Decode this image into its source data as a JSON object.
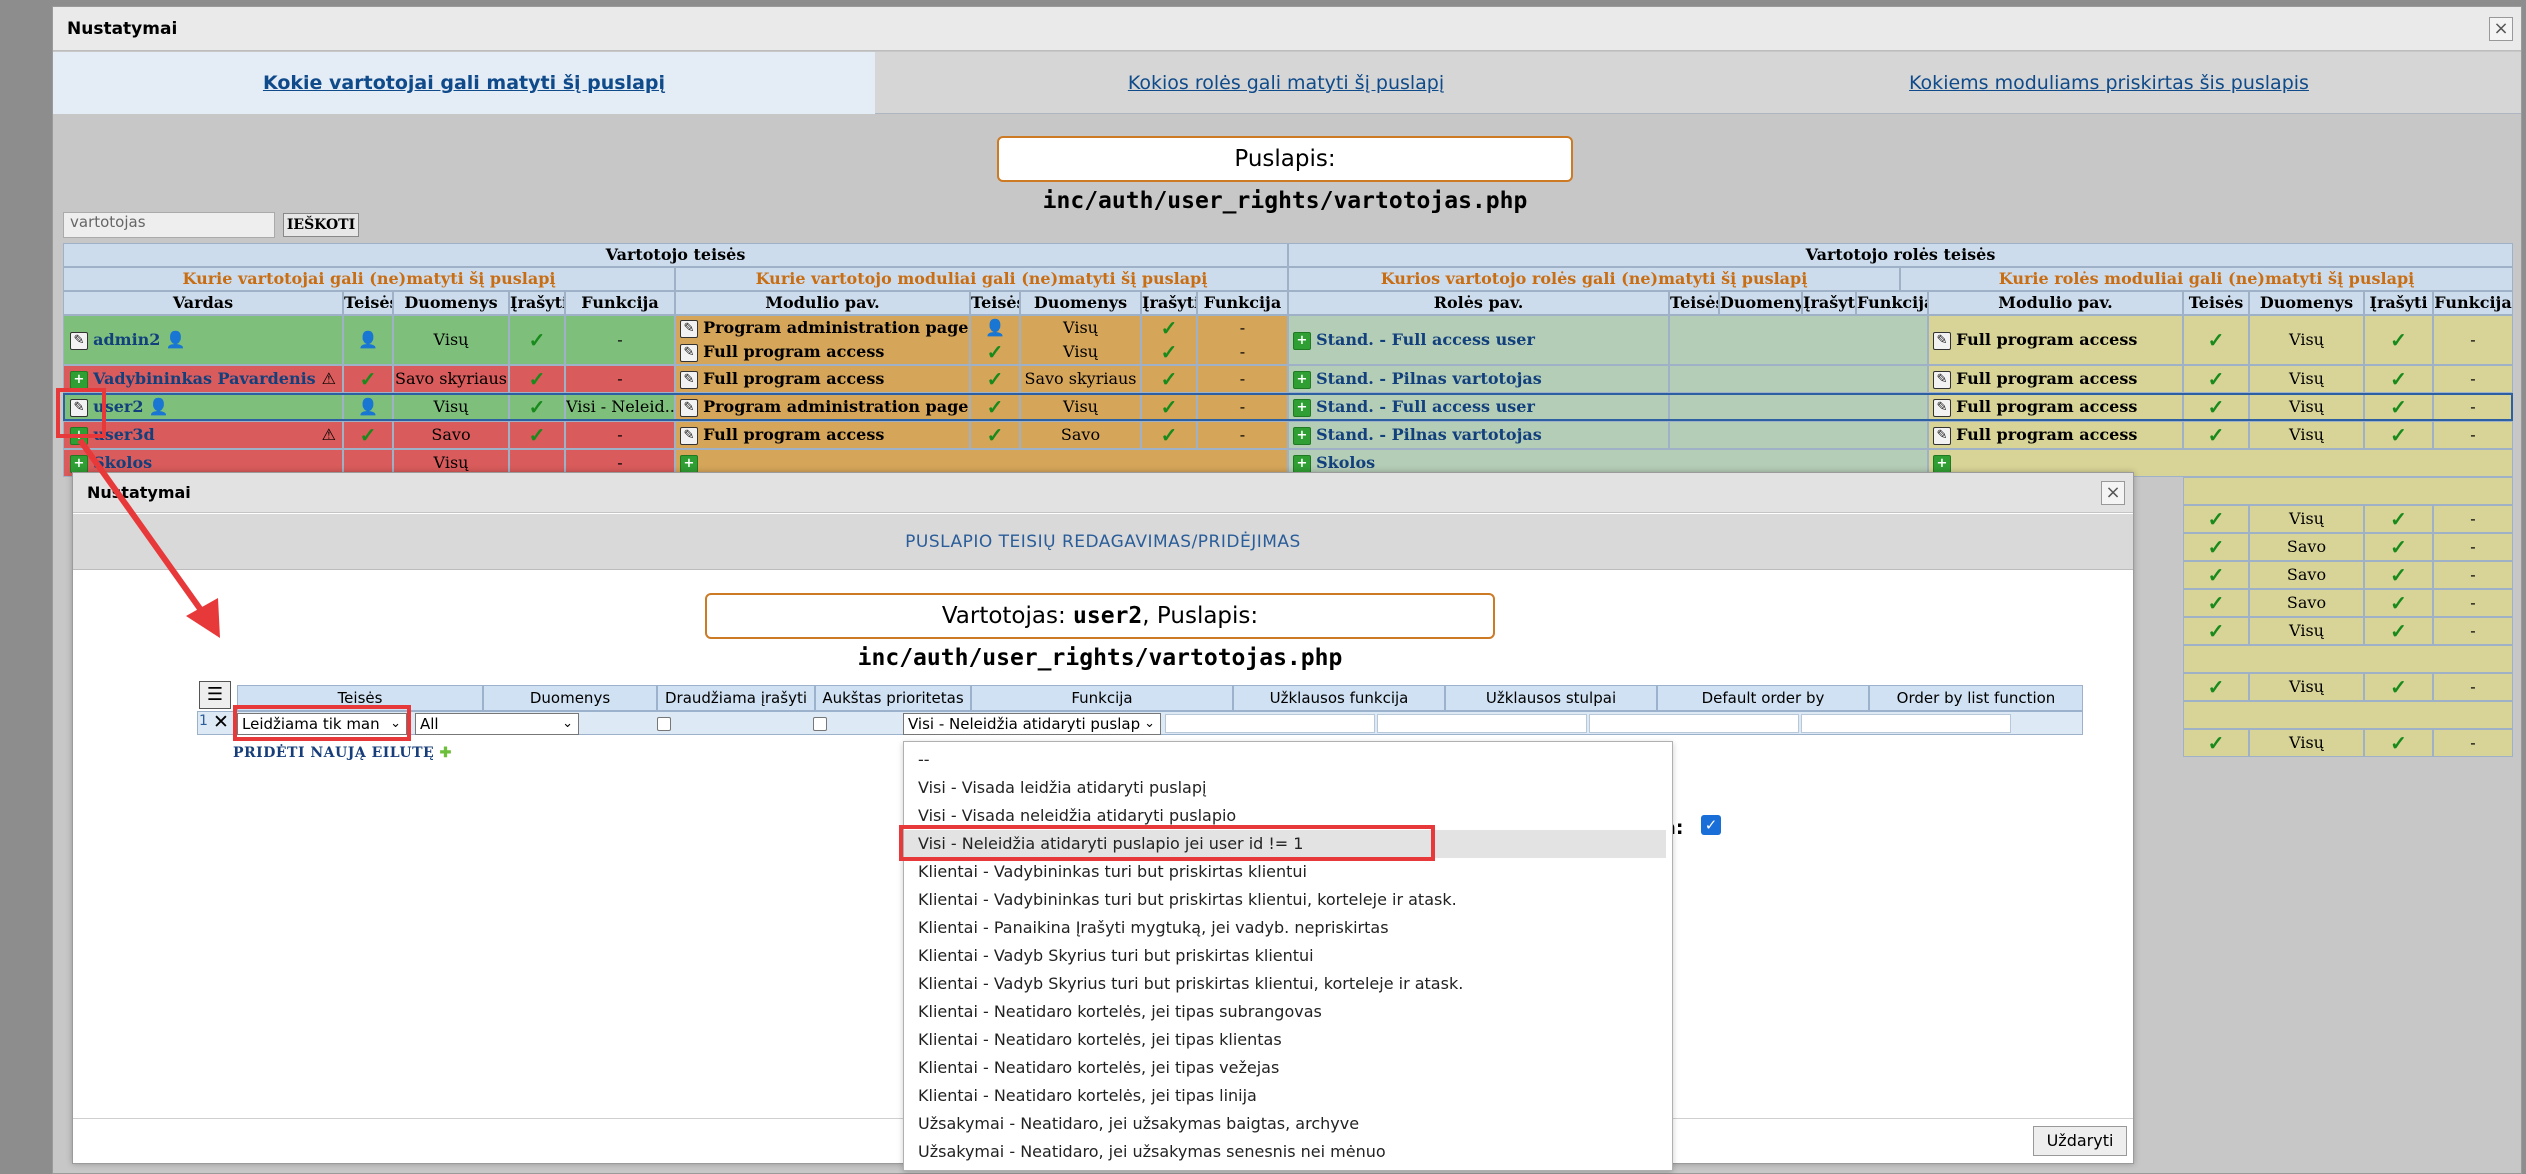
{
  "outer": {
    "title": "Nustatymai",
    "close": "×",
    "tabs": [
      "Kokie vartotojai gali matyti šį puslapį",
      "Kokios rolės gali matyti šį puslapį",
      "Kokiems moduliams priskirtas šis puslapis"
    ],
    "page_label": "Puslapis:",
    "page_value": "inc/auth/user_rights/vartotojas.php",
    "search_placeholder": "vartotojas",
    "search_button": "IEŠKOTI"
  },
  "grid": {
    "group_user": "Vartotojo teisės",
    "group_role": "Vartotojo rolės teisės",
    "sub": [
      "Kurie vartotojai gali (ne)matyti šį puslapį",
      "Kurie vartotojo moduliai gali (ne)matyti šį puslapį",
      "Kurios vartotojo rolės gali (ne)matyti šį puslapį",
      "Kurie rolės moduliai gali (ne)matyti šį puslapį"
    ],
    "cols": [
      "Vardas",
      "Teisės",
      "Duomenys",
      "Įrašyti",
      "Funkcija",
      "Modulio pav.",
      "Teisės",
      "Duomenys",
      "Įrašyti",
      "Funkcija",
      "Rolės pav.",
      "Teisės",
      "Duomenys",
      "Įrašyti",
      "Funkcija",
      "Modulio pav.",
      "Teisės",
      "Duomenys",
      "Įrašyti",
      "Funkcija"
    ],
    "rows": [
      {
        "name": "admin2",
        "data": "Visų",
        "func": "-",
        "mod1": "Program administration pages",
        "mod2": "Full program access",
        "mdata1": "Visų",
        "mdata2": "Visų",
        "mfunc1": "-",
        "mfunc2": "-",
        "role": "Stand. - Full access user",
        "rmod": "Full program access",
        "rdata": "Visų",
        "rfunc": "-"
      },
      {
        "name": "Vadybininkas Pavardenis",
        "data": "Savo skyriaus",
        "func": "-",
        "mod1": "Full program access",
        "mdata1": "Savo skyriaus",
        "mfunc1": "-",
        "role": "Stand. - Pilnas vartotojas",
        "rmod": "Full program access",
        "rdata": "Visų",
        "rfunc": "-"
      },
      {
        "name": "user2",
        "data": "Visų",
        "func": "Visi - Neleid..",
        "mod1": "Program administration pages",
        "mdata1": "Visų",
        "mfunc1": "-",
        "role": "Stand. - Full access user",
        "rmod": "Full program access",
        "rdata": "Visų",
        "rfunc": "-"
      },
      {
        "name": "user3d",
        "data": "Savo",
        "func": "-",
        "mod1": "Full program access",
        "mdata1": "Savo",
        "mfunc1": "-",
        "role": "Stand. - Pilnas vartotojas",
        "rmod": "Full program access",
        "rdata": "Visų",
        "rfunc": "-"
      },
      {
        "name": "Skolos",
        "data": "Visų",
        "func": "-",
        "role": "Skolos"
      }
    ],
    "extra_rdata": [
      "Visų",
      "Savo",
      "Savo",
      "Savo",
      "Visų",
      "",
      "Visų",
      "",
      "Visų"
    ],
    "dash": "-"
  },
  "inner": {
    "title": "Nustatymai",
    "close": "×",
    "heading": "PUSLAPIO TEISIŲ REDAGAVIMAS/PRIDĖJIMAS",
    "user_label": "Vartotojas:",
    "user_value": "user2",
    "page_label": ", Puslapis:",
    "page_value": "inc/auth/user_rights/vartotojas.php",
    "table_headers": [
      "Teisės",
      "Duomenys",
      "Draudžiama įrašyti",
      "Aukštas prioritetas",
      "Funkcija",
      "Užklausos funkcija",
      "Užklausos stulpai",
      "Default order by",
      "Order by list function"
    ],
    "row_num": "1",
    "row_delete": "✕",
    "teises_value": "Leidžiama tik man",
    "duomenys_value": "All",
    "funkcija_value": "Visi - Neleidžia atidaryti puslap",
    "add_row": "PRIDĖTI NAUJĄ EILUTĘ",
    "right_label": "a:",
    "close_button": "Uždaryti",
    "dropdown": [
      "--",
      "Visi - Visada leidžia atidaryti puslapį",
      "Visi - Visada neleidžia atidaryti puslapio",
      "Visi - Neleidžia atidaryti puslapio jei user id != 1",
      "Klientai - Vadybininkas turi but priskirtas klientui",
      "Klientai - Vadybininkas turi but priskirtas klientui, korteleje ir atask.",
      "Klientai - Panaikina Įrašyti mygtuką, jei vadyb. nepriskirtas",
      "Klientai - Vadyb Skyrius turi but priskirtas klientui",
      "Klientai - Vadyb Skyrius turi but priskirtas klientui, korteleje ir atask.",
      "Klientai - Neatidaro kortelės, jei tipas subrangovas",
      "Klientai - Neatidaro kortelės, jei tipas klientas",
      "Klientai - Neatidaro kortelės, jei tipas vežejas",
      "Klientai - Neatidaro kortelės, jei tipas linija",
      "Užsakymai - Neatidaro, jei užsakymas baigtas, archyve",
      "Užsakymai - Neatidaro, jei užsakymas senesnis nei mėnuo"
    ]
  },
  "colors": {
    "accent": "#0f4a8a",
    "highlight": "#e8393a",
    "orange": "#c96d13",
    "check": "#198a1c"
  }
}
